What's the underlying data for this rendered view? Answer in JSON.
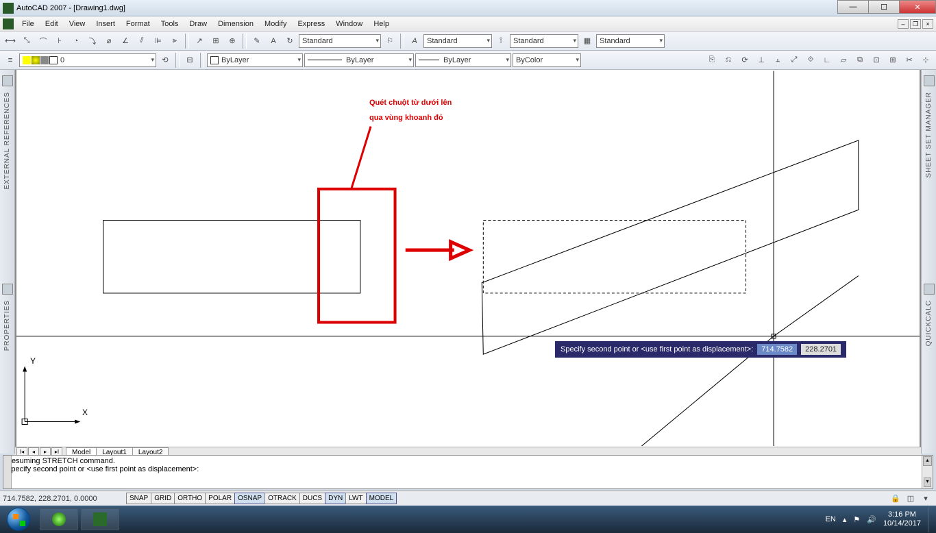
{
  "titlebar": {
    "title": "AutoCAD 2007 - [Drawing1.dwg]"
  },
  "menubar": {
    "items": [
      "File",
      "Edit",
      "View",
      "Insert",
      "Format",
      "Tools",
      "Draw",
      "Dimension",
      "Modify",
      "Express",
      "Window",
      "Help"
    ]
  },
  "style_combos": {
    "text_style": "Standard",
    "dim_style": "Standard",
    "table_style": "Standard",
    "ml_style": "Standard"
  },
  "layer": {
    "current": "0"
  },
  "props": {
    "color": "ByLayer",
    "linetype": "ByLayer",
    "lineweight": "ByLayer",
    "plotstyle": "ByColor"
  },
  "side_left": {
    "top": "EXTERNAL REFERENCES",
    "bottom": "PROPERTIES"
  },
  "side_right": {
    "top": "SHEET SET MANAGER",
    "bottom": "QUICKCALC"
  },
  "tabs": {
    "items": [
      "Model",
      "Layout1",
      "Layout2"
    ],
    "active": "Model"
  },
  "command": {
    "line1": "Resuming STRETCH command.",
    "line2": "Specify second point or <use first point as displacement>:"
  },
  "dynamic": {
    "prompt": "Specify second point or <use first point as displacement>:",
    "x": "714.7582",
    "y": "228.2701"
  },
  "status": {
    "coords": "714.7582, 228.2701, 0.0000",
    "buttons": [
      "SNAP",
      "GRID",
      "ORTHO",
      "POLAR",
      "OSNAP",
      "OTRACK",
      "DUCS",
      "DYN",
      "LWT",
      "MODEL"
    ],
    "active": [
      "OSNAP",
      "DYN",
      "MODEL"
    ]
  },
  "annotation": {
    "line1": "Quét chuột từ dưới lên",
    "line2": "qua vùng khoanh đỏ"
  },
  "taskbar": {
    "lang": "EN",
    "time": "3:16 PM",
    "date": "10/14/2017"
  },
  "ucs": {
    "x": "X",
    "y": "Y"
  }
}
